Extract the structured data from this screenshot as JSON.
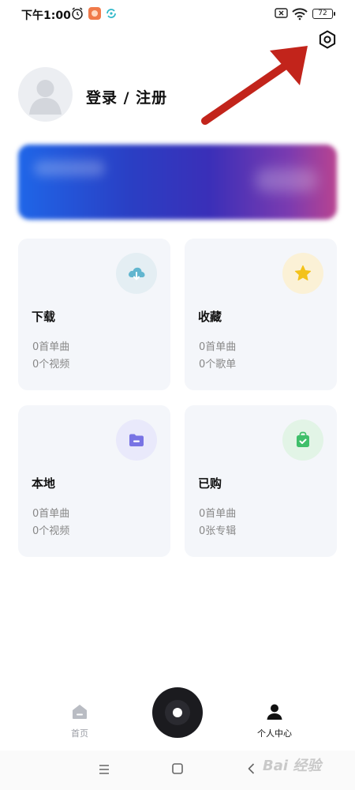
{
  "status_bar": {
    "time": "下午1:00",
    "battery": "72",
    "icons": [
      "alarm-icon",
      "app-notification-icon",
      "sync-icon",
      "sim-x-icon",
      "wifi-icon",
      "battery-icon"
    ]
  },
  "header": {
    "settings_icon": "settings-icon"
  },
  "profile": {
    "login_label": "登录 / 注册"
  },
  "cards": [
    {
      "title": "下载",
      "line1": "0首单曲",
      "line2": "0个视频",
      "icon": "cloud-download-icon",
      "icon_bg": "#e4eef3",
      "icon_color": "#62b6cf"
    },
    {
      "title": "收藏",
      "line1": "0首单曲",
      "line2": "0个歌单",
      "icon": "star-icon",
      "icon_bg": "#fbf1d6",
      "icon_color": "#f3c21a"
    },
    {
      "title": "本地",
      "line1": "0首单曲",
      "line2": "0个视频",
      "icon": "folder-icon",
      "icon_bg": "#e9e9fb",
      "icon_color": "#7873e4"
    },
    {
      "title": "已购",
      "line1": "0首单曲",
      "line2": "0张专辑",
      "icon": "shopping-bag-icon",
      "icon_bg": "#e2f4e6",
      "icon_color": "#3fbf6a"
    }
  ],
  "bottom_nav": {
    "home_label": "首页",
    "profile_label": "个人中心"
  },
  "watermark": "Bai 经验",
  "colors": {
    "card_bg": "#f4f6fa",
    "accent_red": "#c2241b"
  }
}
